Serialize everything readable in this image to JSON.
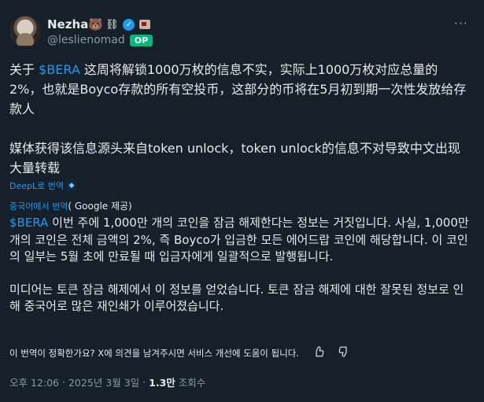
{
  "author": {
    "display_name": "Nezha🐻",
    "name_extras": "⛓",
    "handle": "@leslienomad",
    "op_badge": "OP",
    "more_icon": "more-dots-icon"
  },
  "original": {
    "cashtag": "$BERA",
    "para1_prefix": "关于 ",
    "para1_rest": " 这周将解锁1000万枚的信息不实，实际上1000万枚对应总量的2%，也就是Boyco存款的所有空投币，这部分的币将在5月初到期一次性发放给存款人",
    "para2": "媒体获得该信息源头来自token unlock，token unlock的信息不对导致中文出现大量转载"
  },
  "translation_meta": {
    "deepl_label": "DeepL로 번역",
    "translated_from": "중국어에서 번역",
    "provider": "( Google 제공)"
  },
  "translation": {
    "cashtag": "$BERA",
    "para1_rest": " 이번 주에 1,000만 개의 코인을 잠금 해제한다는 정보는 거짓입니다. 사실, 1,000만 개의 코인은 전체 금액의 2%, 즉 Boyco가 입금한 모든 에어드랍 코인에 해당합니다. 이 코인의 일부는 5월 초에 만료될 때 입금자에게 일괄적으로 발행됩니다.",
    "para2": "미디어는 토큰 잠금 해제에서 이 정보를 얻었습니다. 토큰 잠금 해제에 대한 잘못된 정보로 인해 중국어로 많은 재인쇄가 이루어졌습니다."
  },
  "feedback": {
    "question": "이 번역이 정확한가요? X에 의견을 남겨주시면 서비스 개선에 도움이 됩니다."
  },
  "meta": {
    "time": "오후 12:06",
    "date": "2025년 3월 3일",
    "views_count": "1.3만",
    "views_label": "조회수"
  },
  "colors": {
    "background": "#15202b",
    "link": "#1d9bf0",
    "op_badge": "#00ba7c",
    "muted": "#8b98a5"
  }
}
